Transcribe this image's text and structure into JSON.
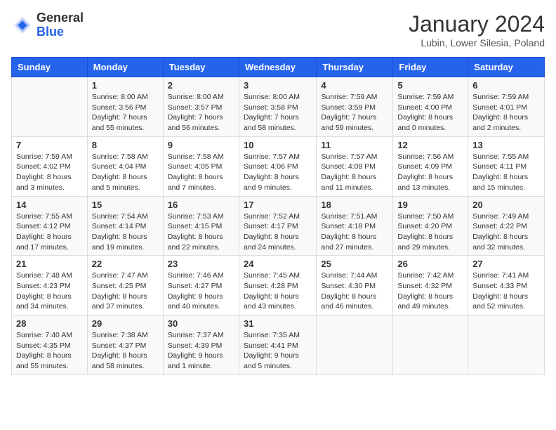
{
  "header": {
    "logo_general": "General",
    "logo_blue": "Blue",
    "month_year": "January 2024",
    "location": "Lubin, Lower Silesia, Poland"
  },
  "days_of_week": [
    "Sunday",
    "Monday",
    "Tuesday",
    "Wednesday",
    "Thursday",
    "Friday",
    "Saturday"
  ],
  "weeks": [
    [
      {
        "day": "",
        "info": ""
      },
      {
        "day": "1",
        "info": "Sunrise: 8:00 AM\nSunset: 3:56 PM\nDaylight: 7 hours\nand 55 minutes."
      },
      {
        "day": "2",
        "info": "Sunrise: 8:00 AM\nSunset: 3:57 PM\nDaylight: 7 hours\nand 56 minutes."
      },
      {
        "day": "3",
        "info": "Sunrise: 8:00 AM\nSunset: 3:58 PM\nDaylight: 7 hours\nand 58 minutes."
      },
      {
        "day": "4",
        "info": "Sunrise: 7:59 AM\nSunset: 3:59 PM\nDaylight: 7 hours\nand 59 minutes."
      },
      {
        "day": "5",
        "info": "Sunrise: 7:59 AM\nSunset: 4:00 PM\nDaylight: 8 hours\nand 0 minutes."
      },
      {
        "day": "6",
        "info": "Sunrise: 7:59 AM\nSunset: 4:01 PM\nDaylight: 8 hours\nand 2 minutes."
      }
    ],
    [
      {
        "day": "7",
        "info": "Sunrise: 7:59 AM\nSunset: 4:02 PM\nDaylight: 8 hours\nand 3 minutes."
      },
      {
        "day": "8",
        "info": "Sunrise: 7:58 AM\nSunset: 4:04 PM\nDaylight: 8 hours\nand 5 minutes."
      },
      {
        "day": "9",
        "info": "Sunrise: 7:58 AM\nSunset: 4:05 PM\nDaylight: 8 hours\nand 7 minutes."
      },
      {
        "day": "10",
        "info": "Sunrise: 7:57 AM\nSunset: 4:06 PM\nDaylight: 8 hours\nand 9 minutes."
      },
      {
        "day": "11",
        "info": "Sunrise: 7:57 AM\nSunset: 4:08 PM\nDaylight: 8 hours\nand 11 minutes."
      },
      {
        "day": "12",
        "info": "Sunrise: 7:56 AM\nSunset: 4:09 PM\nDaylight: 8 hours\nand 13 minutes."
      },
      {
        "day": "13",
        "info": "Sunrise: 7:55 AM\nSunset: 4:11 PM\nDaylight: 8 hours\nand 15 minutes."
      }
    ],
    [
      {
        "day": "14",
        "info": "Sunrise: 7:55 AM\nSunset: 4:12 PM\nDaylight: 8 hours\nand 17 minutes."
      },
      {
        "day": "15",
        "info": "Sunrise: 7:54 AM\nSunset: 4:14 PM\nDaylight: 8 hours\nand 19 minutes."
      },
      {
        "day": "16",
        "info": "Sunrise: 7:53 AM\nSunset: 4:15 PM\nDaylight: 8 hours\nand 22 minutes."
      },
      {
        "day": "17",
        "info": "Sunrise: 7:52 AM\nSunset: 4:17 PM\nDaylight: 8 hours\nand 24 minutes."
      },
      {
        "day": "18",
        "info": "Sunrise: 7:51 AM\nSunset: 4:18 PM\nDaylight: 8 hours\nand 27 minutes."
      },
      {
        "day": "19",
        "info": "Sunrise: 7:50 AM\nSunset: 4:20 PM\nDaylight: 8 hours\nand 29 minutes."
      },
      {
        "day": "20",
        "info": "Sunrise: 7:49 AM\nSunset: 4:22 PM\nDaylight: 8 hours\nand 32 minutes."
      }
    ],
    [
      {
        "day": "21",
        "info": "Sunrise: 7:48 AM\nSunset: 4:23 PM\nDaylight: 8 hours\nand 34 minutes."
      },
      {
        "day": "22",
        "info": "Sunrise: 7:47 AM\nSunset: 4:25 PM\nDaylight: 8 hours\nand 37 minutes."
      },
      {
        "day": "23",
        "info": "Sunrise: 7:46 AM\nSunset: 4:27 PM\nDaylight: 8 hours\nand 40 minutes."
      },
      {
        "day": "24",
        "info": "Sunrise: 7:45 AM\nSunset: 4:28 PM\nDaylight: 8 hours\nand 43 minutes."
      },
      {
        "day": "25",
        "info": "Sunrise: 7:44 AM\nSunset: 4:30 PM\nDaylight: 8 hours\nand 46 minutes."
      },
      {
        "day": "26",
        "info": "Sunrise: 7:42 AM\nSunset: 4:32 PM\nDaylight: 8 hours\nand 49 minutes."
      },
      {
        "day": "27",
        "info": "Sunrise: 7:41 AM\nSunset: 4:33 PM\nDaylight: 8 hours\nand 52 minutes."
      }
    ],
    [
      {
        "day": "28",
        "info": "Sunrise: 7:40 AM\nSunset: 4:35 PM\nDaylight: 8 hours\nand 55 minutes."
      },
      {
        "day": "29",
        "info": "Sunrise: 7:38 AM\nSunset: 4:37 PM\nDaylight: 8 hours\nand 58 minutes."
      },
      {
        "day": "30",
        "info": "Sunrise: 7:37 AM\nSunset: 4:39 PM\nDaylight: 9 hours\nand 1 minute."
      },
      {
        "day": "31",
        "info": "Sunrise: 7:35 AM\nSunset: 4:41 PM\nDaylight: 9 hours\nand 5 minutes."
      },
      {
        "day": "",
        "info": ""
      },
      {
        "day": "",
        "info": ""
      },
      {
        "day": "",
        "info": ""
      }
    ]
  ]
}
